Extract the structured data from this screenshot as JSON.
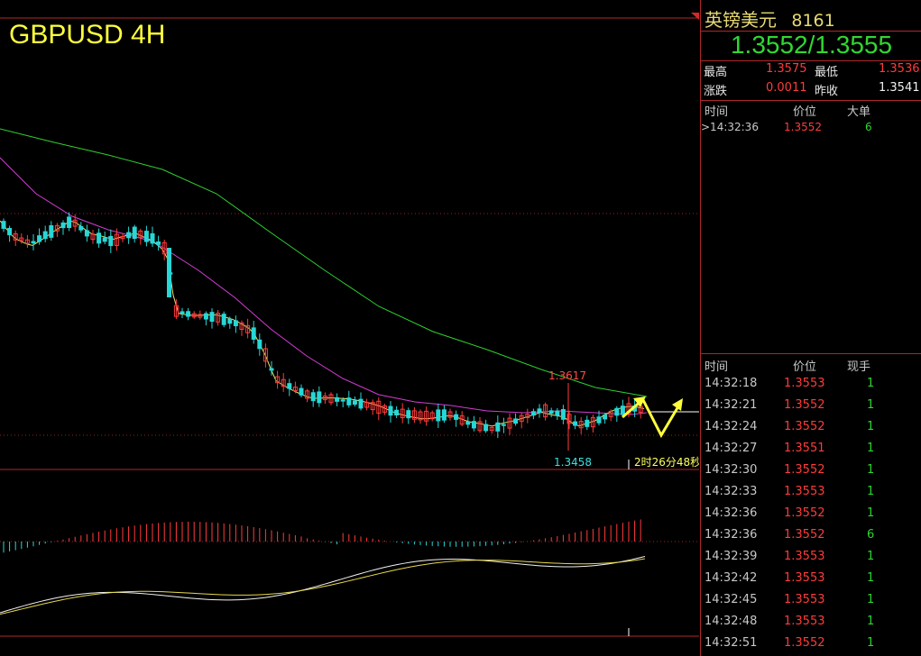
{
  "chart_title": "GBPUSD 4H",
  "chart": {
    "high_marker": "1.3617",
    "low_marker": "1.3458",
    "countdown": "2时26分48秒"
  },
  "quote": {
    "name": "英镑美元",
    "code": "8161",
    "bid_ask": "1.3552/1.3555",
    "high_label": "最高",
    "high": "1.3575",
    "low_label": "最低",
    "low": "1.3536",
    "change_label": "涨跌",
    "change": "0.0011",
    "prev_close_label": "昨收",
    "prev_close": "1.3541"
  },
  "big_orders": {
    "headers": [
      "时间",
      "价位",
      "大单"
    ],
    "rows": [
      {
        "time": ">14:32:36",
        "price": "1.3552",
        "qty": "6"
      }
    ]
  },
  "ticks": {
    "headers": [
      "时间",
      "价位",
      "现手"
    ],
    "rows": [
      {
        "time": "14:32:18",
        "price": "1.3553",
        "qty": "1"
      },
      {
        "time": "14:32:21",
        "price": "1.3552",
        "qty": "1"
      },
      {
        "time": "14:32:24",
        "price": "1.3552",
        "qty": "1"
      },
      {
        "time": "14:32:27",
        "price": "1.3551",
        "qty": "1"
      },
      {
        "time": "14:32:30",
        "price": "1.3552",
        "qty": "1"
      },
      {
        "time": "14:32:33",
        "price": "1.3553",
        "qty": "1"
      },
      {
        "time": "14:32:36",
        "price": "1.3552",
        "qty": "1"
      },
      {
        "time": "14:32:36",
        "price": "1.3552",
        "qty": "6"
      },
      {
        "time": "14:32:39",
        "price": "1.3553",
        "qty": "1"
      },
      {
        "time": "14:32:42",
        "price": "1.3553",
        "qty": "1"
      },
      {
        "time": "14:32:45",
        "price": "1.3553",
        "qty": "1"
      },
      {
        "time": "14:32:48",
        "price": "1.3553",
        "qty": "1"
      },
      {
        "time": "14:32:51",
        "price": "1.3552",
        "qty": "1"
      }
    ]
  },
  "colors": {
    "up": "#ff3b3b",
    "down": "#2fd52f",
    "candle_down": "#27d7d7",
    "grid": "#a02020",
    "ma_green": "#2ecf2e",
    "ma_magenta": "#d43cd4",
    "ma_yellow": "#e6e66e"
  }
}
